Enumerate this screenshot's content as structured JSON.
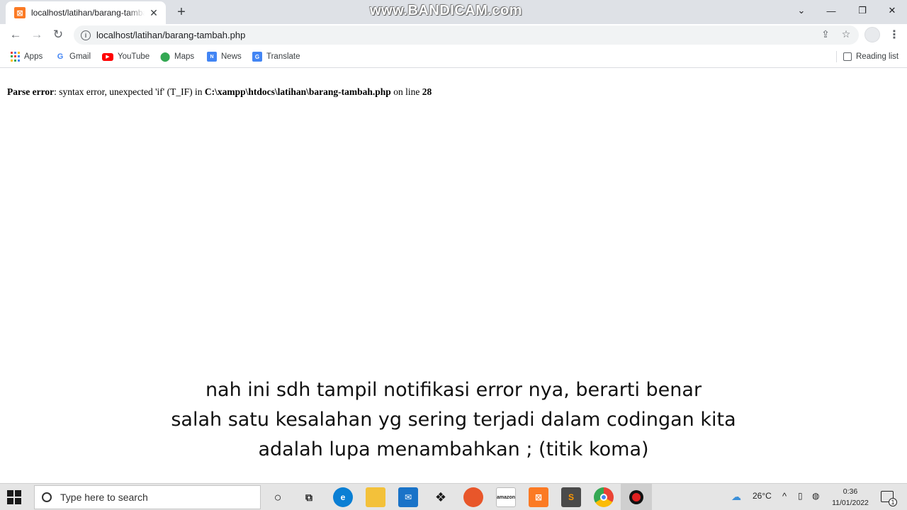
{
  "browser": {
    "tab": {
      "title": "localhost/latihan/barang-tambah.php",
      "favicon": "xampp-icon",
      "close": "✕"
    },
    "new_tab": "+",
    "watermark": "www.BANDICAM.com",
    "window_controls": {
      "dropdown": "⌄",
      "minimize": "—",
      "restore": "❐",
      "close": "✕"
    },
    "nav": {
      "back": "←",
      "forward": "→",
      "reload": "↻"
    },
    "address": {
      "url": "localhost/latihan/barang-tambah.php",
      "info": "i"
    },
    "omnibox_actions": {
      "share": "⇪",
      "bookmark": "☆"
    },
    "menu": "⋮"
  },
  "bookmarks": [
    {
      "label": "Apps",
      "icon": "apps-grid-icon"
    },
    {
      "label": "Gmail",
      "icon": "gmail-icon"
    },
    {
      "label": "YouTube",
      "icon": "youtube-icon"
    },
    {
      "label": "Maps",
      "icon": "maps-icon"
    },
    {
      "label": "News",
      "icon": "news-icon"
    },
    {
      "label": "Translate",
      "icon": "translate-icon"
    }
  ],
  "reading_list": "Reading list",
  "page": {
    "error_label": "Parse error",
    "error_message": ": syntax error, unexpected 'if' (T_IF) in ",
    "error_path": "C:\\xampp\\htdocs\\latihan\\barang-tambah.php",
    "error_online": " on line ",
    "error_line_number": "28"
  },
  "subtitle": {
    "line1": "nah ini sdh tampil notifikasi error nya, berarti benar",
    "line2": "salah satu kesalahan yg sering terjadi dalam codingan kita",
    "line3": "adalah lupa menambahkan ; (titik koma)"
  },
  "taskbar": {
    "search_placeholder": "Type here to search",
    "apps": [
      "cortana-icon",
      "task-view-icon",
      "edge-icon",
      "file-explorer-icon",
      "mail-icon",
      "dropbox-icon",
      "firefox-icon",
      "amazon-icon",
      "xampp-icon",
      "sublime-icon",
      "chrome-icon",
      "bandicam-record-icon"
    ],
    "weather": "26°C",
    "chevron": "^",
    "time": "0:36",
    "date": "11/01/2022",
    "notification_count": "1"
  },
  "colors": {
    "tabstrip": "#dee1e6",
    "xampp": "#fb7a24",
    "taskbar": "#e5e5e5",
    "text": "#202124"
  }
}
